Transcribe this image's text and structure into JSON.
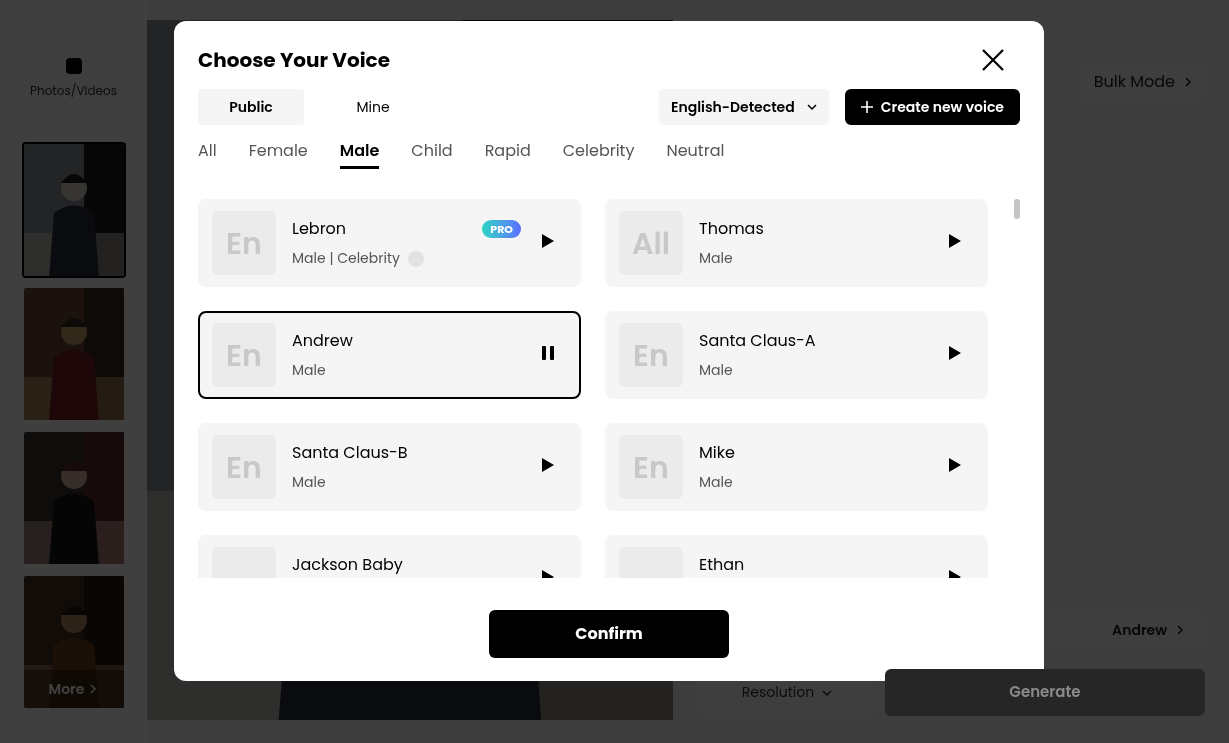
{
  "sidebar": {
    "upload_label": "Photos/Videos",
    "thumbnails": [
      {
        "kind": "picture",
        "selected": true
      },
      {
        "kind": "picture",
        "selected": false
      },
      {
        "kind": "picture",
        "selected": false
      },
      {
        "kind": "picture",
        "selected": false
      }
    ],
    "more": "More"
  },
  "right_panel": {
    "bulk_mode": "Bulk Mode",
    "voice_value": "Andrew",
    "resolution": "Resolution",
    "generate": "Generate"
  },
  "dialog": {
    "title": "Choose Your Voice",
    "source_tabs": [
      {
        "label": "Public",
        "selected": true
      },
      {
        "label": "Mine",
        "selected": false
      }
    ],
    "language": "English-Detected",
    "create_button": "Create new voice",
    "category_tabs": [
      {
        "label": "All",
        "selected": false
      },
      {
        "label": "Female",
        "selected": false
      },
      {
        "label": "Male",
        "selected": true
      },
      {
        "label": "Child",
        "selected": false
      },
      {
        "label": "Rapid",
        "selected": false
      },
      {
        "label": "Celebrity",
        "selected": false
      },
      {
        "label": "Neutral",
        "selected": false
      }
    ],
    "voices": [
      {
        "avatar": "En",
        "name": "Lebron",
        "subtitle": "Male | Celebrity",
        "pro": true,
        "info": true,
        "selected": false,
        "playing": false
      },
      {
        "avatar": "All",
        "name": "Thomas",
        "subtitle": "Male",
        "pro": false,
        "info": false,
        "selected": false,
        "playing": false
      },
      {
        "avatar": "En",
        "name": "Andrew",
        "subtitle": "Male",
        "pro": false,
        "info": false,
        "selected": true,
        "playing": true
      },
      {
        "avatar": "En",
        "name": "Santa Claus-A",
        "subtitle": "Male",
        "pro": false,
        "info": false,
        "selected": false,
        "playing": false
      },
      {
        "avatar": "En",
        "name": "Santa Claus-B",
        "subtitle": "Male",
        "pro": false,
        "info": false,
        "selected": false,
        "playing": false
      },
      {
        "avatar": "En",
        "name": "Mike",
        "subtitle": "Male",
        "pro": false,
        "info": false,
        "selected": false,
        "playing": false
      },
      {
        "name": "Jackson Baby",
        "selected": false,
        "playing": false
      },
      {
        "name": "Ethan",
        "selected": false,
        "playing": false
      }
    ],
    "pro_label": "PRO",
    "confirm": "Confirm"
  }
}
